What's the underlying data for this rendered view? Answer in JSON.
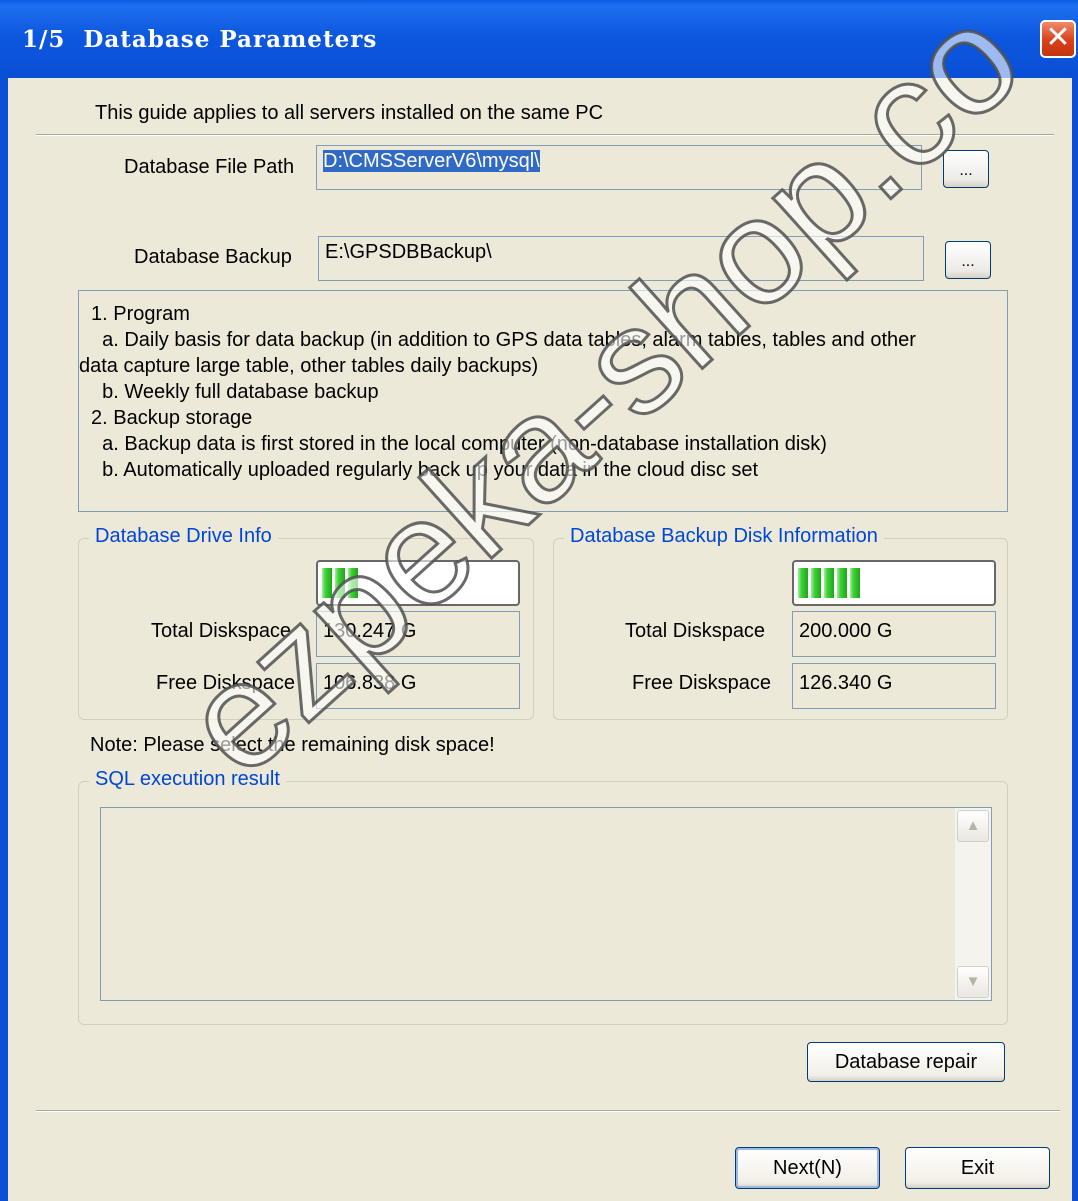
{
  "window": {
    "title": "1/5  Database Parameters",
    "close_icon": "close-icon"
  },
  "intro": "This guide applies to all servers installed on the same PC",
  "db_file_path": {
    "label": "Database File Path",
    "value": "D:\\CMSServerV6\\mysql\\",
    "browse_label": "..."
  },
  "db_backup": {
    "label": "Database Backup",
    "value": "E:\\GPSDBBackup\\",
    "browse_label": "..."
  },
  "info_lines": [
    "1. Program",
    "  a. Daily basis for data backup (in addition to GPS data tables, alarm tables, tables and other",
    "data capture large table, other tables daily backups)",
    "  b. Weekly full database backup",
    "2. Backup storage",
    "  a. Backup data is first stored in the local computer (non-database installation disk)",
    "  b. Automatically uploaded regularly back up your data in the cloud disc set"
  ],
  "drive_info": {
    "legend": "Database Drive Info",
    "usage_fraction": 0.18,
    "total_label": "Total Diskspace",
    "total_value": "130.247 G",
    "free_label": "Free Diskspace",
    "free_value": "106.838 G"
  },
  "backup_disk_info": {
    "legend": "Database Backup Disk Information",
    "usage_fraction": 0.37,
    "total_label": "Total Diskspace",
    "total_value": "200.000 G",
    "free_label": "Free Diskspace",
    "free_value": "126.340 G"
  },
  "note": "Note: Please select the remaining disk space!",
  "sql_result": {
    "legend": "SQL execution result",
    "content": ""
  },
  "buttons": {
    "repair": "Database repair",
    "next": "Next(N)",
    "exit": "Exit"
  },
  "watermark": "ezpeka-shop.co",
  "colors": {
    "titlebar": "#0a4fd6",
    "face": "#ece9d8",
    "legend_text": "#0046d5",
    "progress_fill": "#21a51b"
  }
}
